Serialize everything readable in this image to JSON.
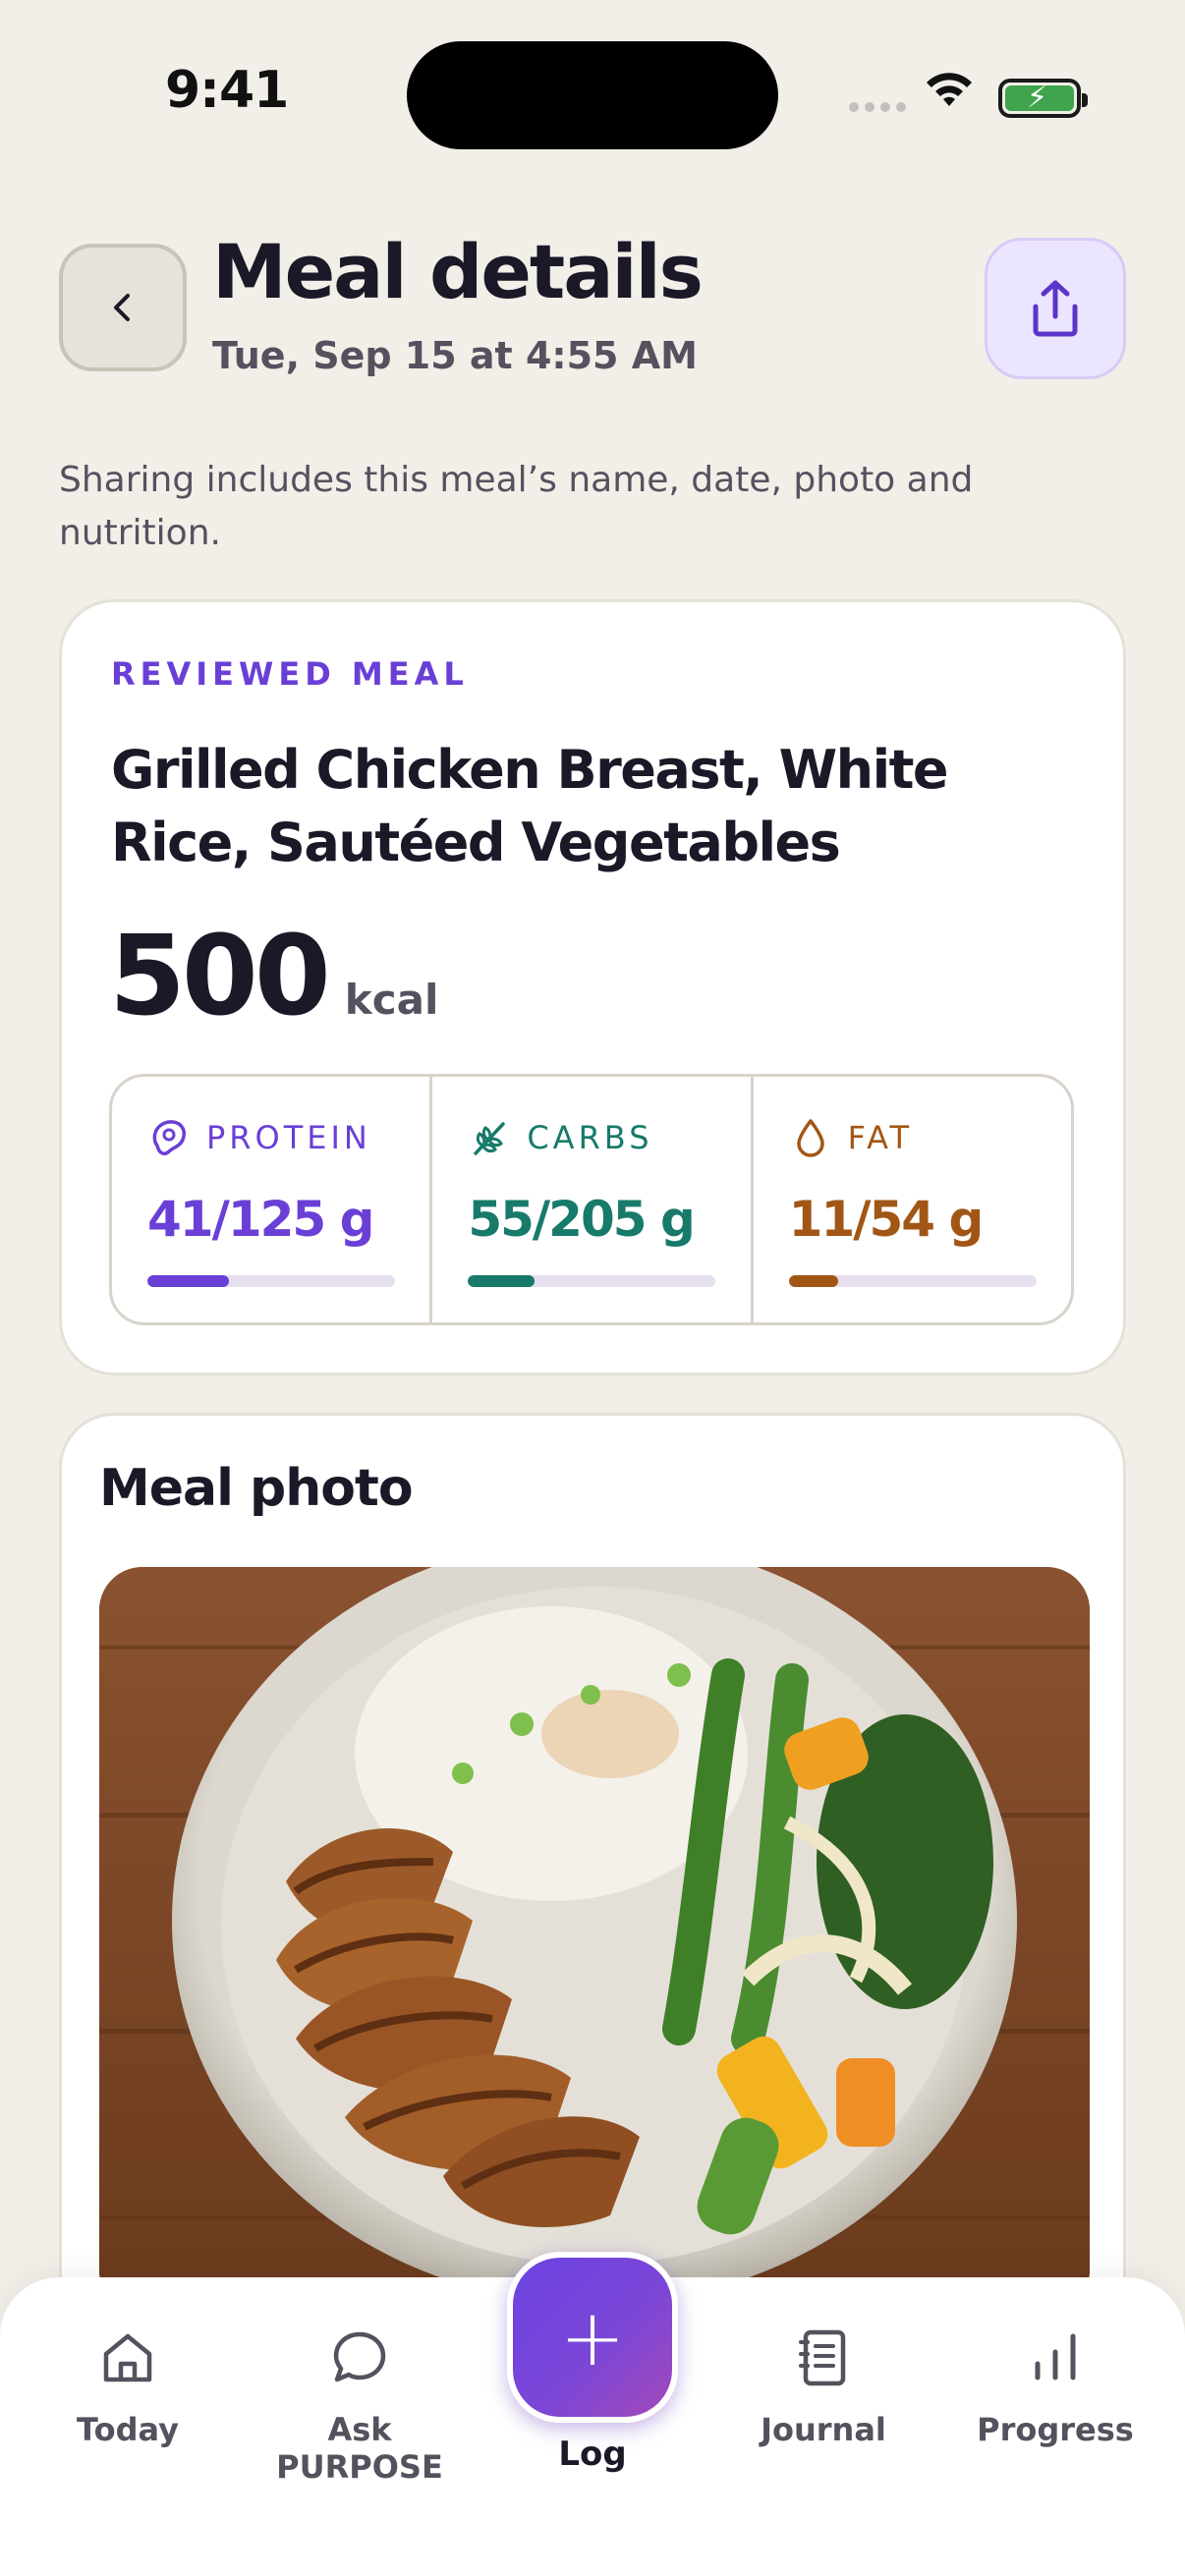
{
  "status_bar": {
    "time": "9:41"
  },
  "header": {
    "title": "Meal details",
    "subtitle": "Tue, Sep 15 at 4:55 AM"
  },
  "share_note": "Sharing includes this meal’s name, date, photo and nutrition.",
  "meal": {
    "badge": "REVIEWED MEAL",
    "name": "Grilled Chicken Breast, White Rice, Sautéed Vegetables",
    "kcal_value": "500",
    "kcal_unit": "kcal",
    "macros": [
      {
        "label": "PROTEIN",
        "value": "41/125 g",
        "progress": 0.33,
        "color": "#6a3fd6",
        "icon": "steak-icon"
      },
      {
        "label": "CARBS",
        "value": "55/205 g",
        "progress": 0.27,
        "color": "#177a6a",
        "icon": "wheat-icon"
      },
      {
        "label": "FAT",
        "value": "11/54 g",
        "progress": 0.2,
        "color": "#a25615",
        "icon": "drop-icon"
      }
    ]
  },
  "photo_section": {
    "title": "Meal photo"
  },
  "nav": {
    "today": "Today",
    "ask": "Ask PURPOSE",
    "log": "Log",
    "journal": "Journal",
    "progress": "Progress"
  }
}
